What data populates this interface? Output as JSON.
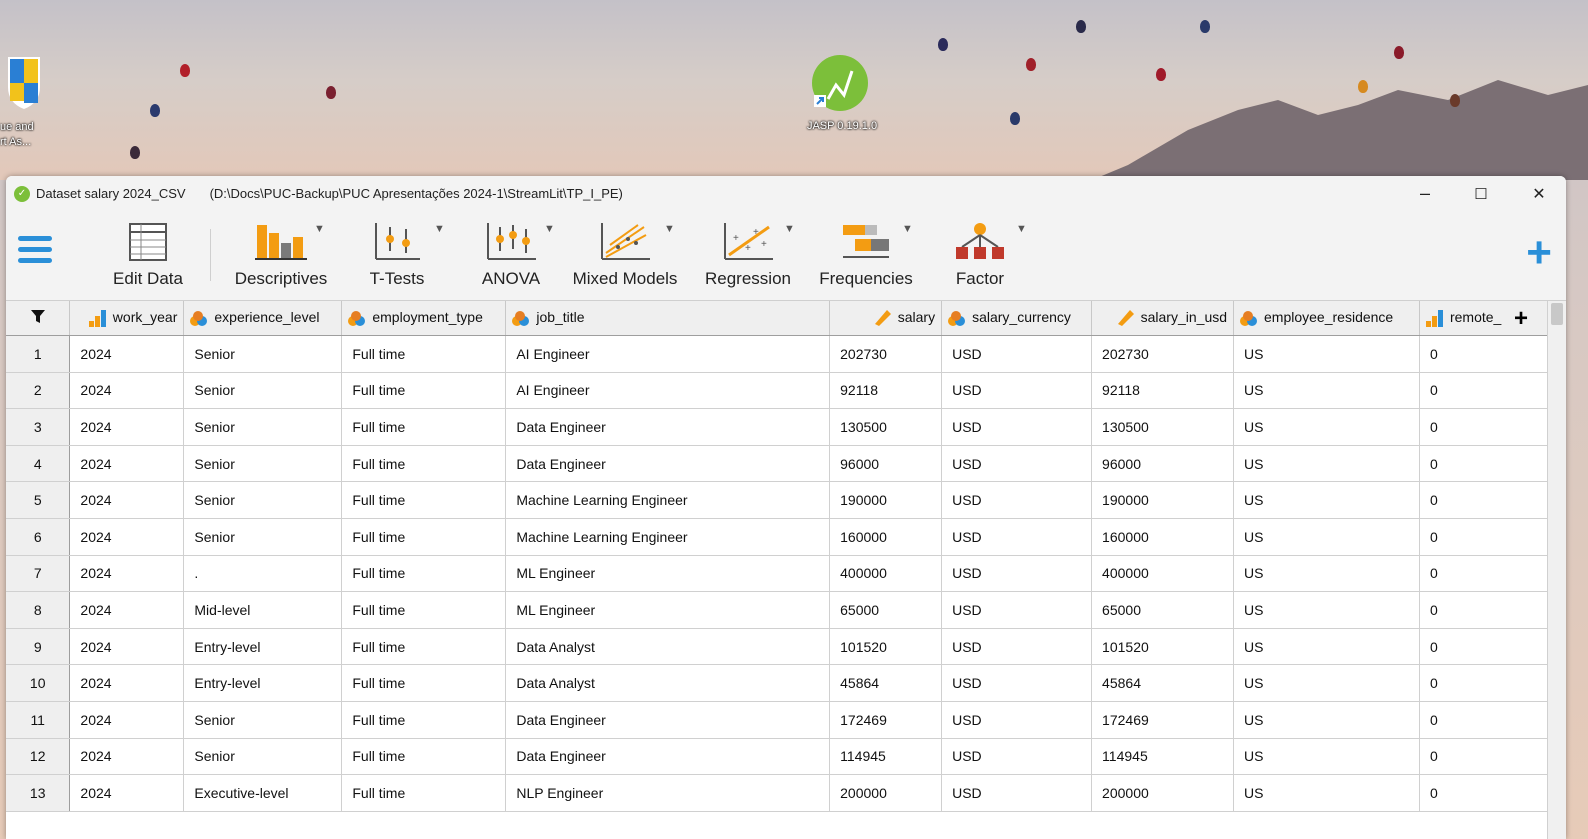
{
  "desktop": {
    "shield_label_line1": "ue and",
    "shield_label_line2": "rt As...",
    "jasp_label": "JASP 0.19.1.0"
  },
  "window": {
    "title": "Dataset salary 2024_CSV",
    "path": "(D:\\Docs\\PUC-Backup\\PUC Apresentações 2024-1\\StreamLit\\TP_I_PE)",
    "minimize": "–",
    "maximize": "☐",
    "close": "✕"
  },
  "ribbon": {
    "edit_data": "Edit Data",
    "descriptives": "Descriptives",
    "t_tests": "T-Tests",
    "anova": "ANOVA",
    "mixed_models": "Mixed Models",
    "regression": "Regression",
    "frequencies": "Frequencies",
    "factor": "Factor",
    "add": "+"
  },
  "grid": {
    "columns": [
      {
        "name": "work_year",
        "type": "ordinal"
      },
      {
        "name": "experience_level",
        "type": "nominal"
      },
      {
        "name": "employment_type",
        "type": "nominal"
      },
      {
        "name": "job_title",
        "type": "nominal"
      },
      {
        "name": "salary",
        "type": "scale"
      },
      {
        "name": "salary_currency",
        "type": "nominal"
      },
      {
        "name": "salary_in_usd",
        "type": "scale"
      },
      {
        "name": "employee_residence",
        "type": "nominal"
      },
      {
        "name": "remote_",
        "type": "ordinal"
      }
    ],
    "add_column": "+",
    "rows": [
      [
        "1",
        "2024",
        "Senior",
        "Full time",
        "AI Engineer",
        "202730",
        "USD",
        "202730",
        "US",
        "0"
      ],
      [
        "2",
        "2024",
        "Senior",
        "Full time",
        "AI Engineer",
        "92118",
        "USD",
        "92118",
        "US",
        "0"
      ],
      [
        "3",
        "2024",
        "Senior",
        "Full time",
        "Data Engineer",
        "130500",
        "USD",
        "130500",
        "US",
        "0"
      ],
      [
        "4",
        "2024",
        "Senior",
        "Full time",
        "Data Engineer",
        "96000",
        "USD",
        "96000",
        "US",
        "0"
      ],
      [
        "5",
        "2024",
        "Senior",
        "Full time",
        "Machine Learning Engineer",
        "190000",
        "USD",
        "190000",
        "US",
        "0"
      ],
      [
        "6",
        "2024",
        "Senior",
        "Full time",
        "Machine Learning Engineer",
        "160000",
        "USD",
        "160000",
        "US",
        "0"
      ],
      [
        "7",
        "2024",
        ".",
        "Full time",
        "ML Engineer",
        "400000",
        "USD",
        "400000",
        "US",
        "0"
      ],
      [
        "8",
        "2024",
        "Mid-level",
        "Full time",
        "ML Engineer",
        "65000",
        "USD",
        "65000",
        "US",
        "0"
      ],
      [
        "9",
        "2024",
        "Entry-level",
        "Full time",
        "Data Analyst",
        "101520",
        "USD",
        "101520",
        "US",
        "0"
      ],
      [
        "10",
        "2024",
        "Entry-level",
        "Full time",
        "Data Analyst",
        "45864",
        "USD",
        "45864",
        "US",
        "0"
      ],
      [
        "11",
        "2024",
        "Senior",
        "Full time",
        "Data Engineer",
        "172469",
        "USD",
        "172469",
        "US",
        "0"
      ],
      [
        "12",
        "2024",
        "Senior",
        "Full time",
        "Data Engineer",
        "114945",
        "USD",
        "114945",
        "US",
        "0"
      ],
      [
        "13",
        "2024",
        "Executive-level",
        "Full time",
        "NLP Engineer",
        "200000",
        "USD",
        "200000",
        "US",
        "0"
      ]
    ]
  },
  "colors": {
    "accent": "#2a8fd8",
    "jasp_green": "#7cbf3a",
    "ordinal_blue": "#2a8fd8",
    "ordinal_orange": "#f39c12"
  }
}
